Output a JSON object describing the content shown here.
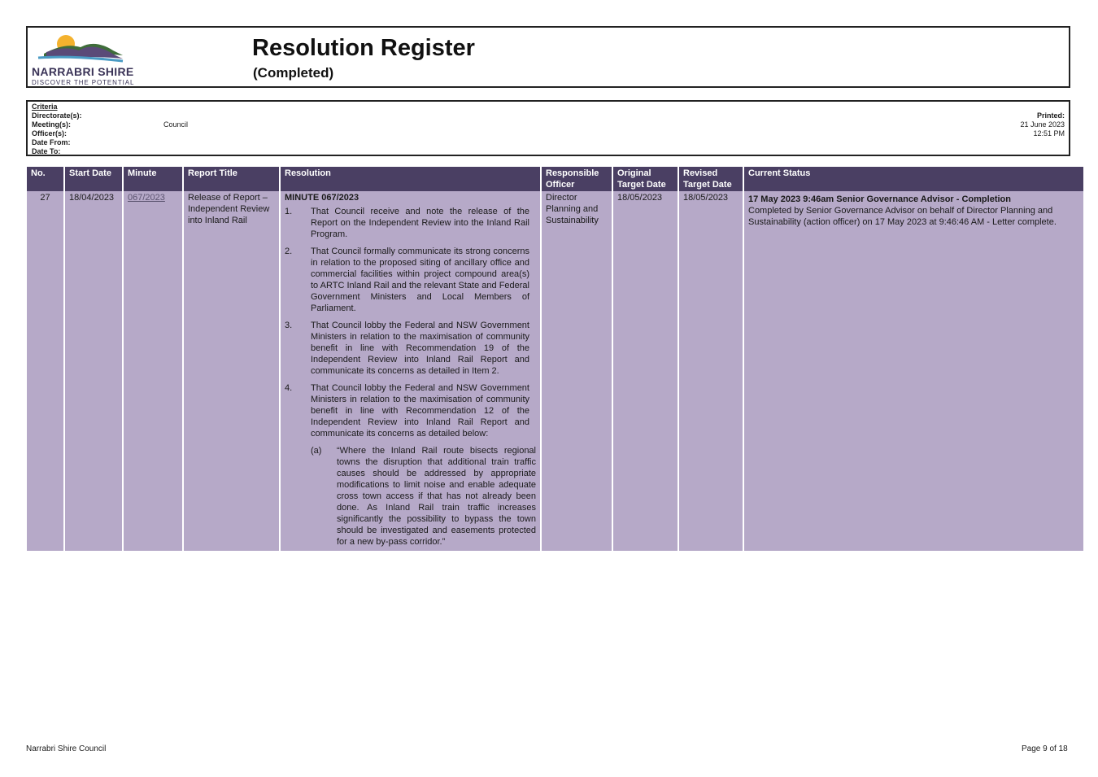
{
  "header": {
    "logo_name": "NARRABRI SHIRE",
    "logo_tagline": "DISCOVER THE POTENTIAL",
    "title": "Resolution Register",
    "subtitle": "(Completed)"
  },
  "criteria": {
    "heading": "Criteria",
    "labels": [
      "Directorate(s):",
      "Meeting(s):",
      "Officer(s):",
      "Date From:",
      "Date To:"
    ],
    "meeting_value": "Council",
    "printed_label": "Printed:",
    "printed_date": "21 June 2023",
    "printed_time": "12:51 PM"
  },
  "table": {
    "headers": [
      "No.",
      "Start Date",
      "Minute",
      "Report Title",
      "Resolution",
      "Responsible Officer",
      "Original Target Date",
      "Revised Target Date",
      "Current Status"
    ],
    "row": {
      "no": "27",
      "start_date": "18/04/2023",
      "minute": "067/2023",
      "report_title": "Release of Report – Independent Review into Inland Rail",
      "resolution_heading": "MINUTE 067/2023",
      "resolution_items": [
        {
          "num": "1.",
          "text": "That Council receive and note the release of the Report on the Independent Review into the Inland Rail Program."
        },
        {
          "num": "2.",
          "text": "That Council formally communicate its strong concerns in relation to the proposed siting of ancillary office and commercial facilities within project compound area(s) to ARTC Inland Rail and the relevant State and Federal Government Ministers and Local Members of Parliament."
        },
        {
          "num": "3.",
          "text": "That Council lobby the Federal and NSW Government Ministers in relation to the maximisation of community benefit in line with Recommendation 19 of the Independent Review into Inland Rail Report and communicate its concerns as detailed in Item 2."
        },
        {
          "num": "4.",
          "text": "That Council lobby the Federal and NSW Government Ministers in relation to the maximisation of community benefit in line with Recommendation 12 of the Independent Review into Inland Rail Report and communicate its concerns as detailed below:"
        }
      ],
      "resolution_sub": {
        "label": "(a)",
        "text": "“Where the Inland Rail route bisects regional towns the disruption that additional train traffic causes should be addressed by appropriate modifications to limit noise and enable adequate cross town access if that has not already been done. As Inland Rail train traffic increases significantly the possibility to bypass the town should be investigated and easements protected for a new by-pass corridor.”"
      },
      "responsible_officer": "Director Planning and Sustainability",
      "original_target_date": "18/05/2023",
      "revised_target_date": "18/05/2023",
      "status_title": "17 May 2023 9:46am Senior Governance Advisor - Completion",
      "status_text": "Completed by Senior Governance Advisor on behalf of Director Planning and Sustainability (action officer) on 17 May 2023 at 9:46:46 AM - Letter complete."
    }
  },
  "footer": {
    "left": "Narrabri Shire Council",
    "right": "Page 9 of 18"
  },
  "colors": {
    "header_row": "#4a3f63",
    "data_row": "#b6a9c8"
  }
}
